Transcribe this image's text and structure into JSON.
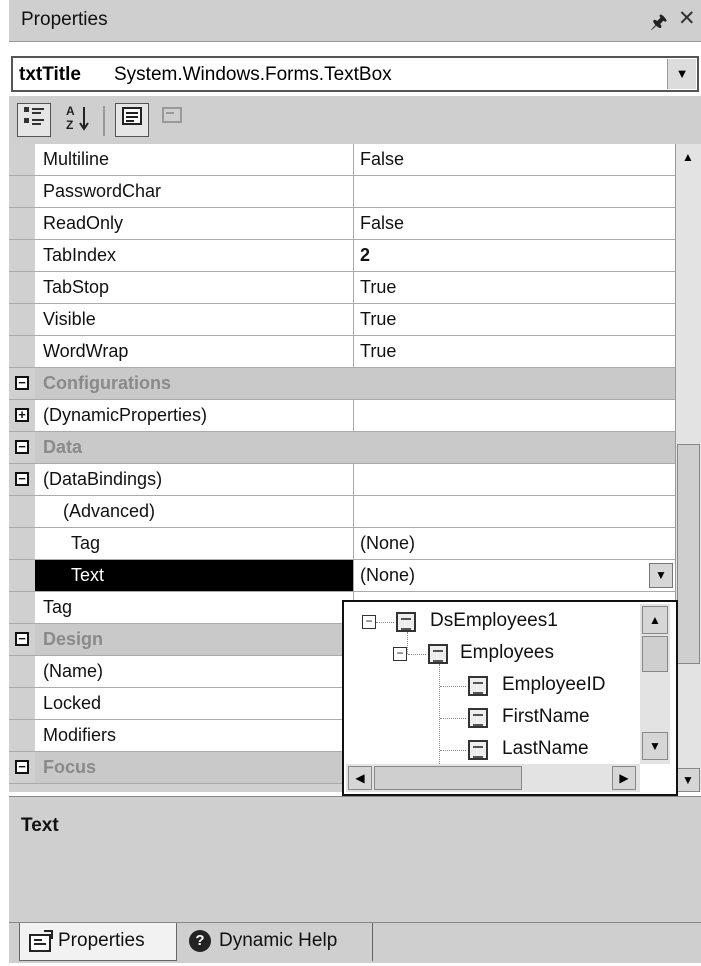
{
  "panel": {
    "title": "Properties",
    "pin_icon": "pin-icon",
    "close_icon": "close-icon"
  },
  "object_selector": {
    "name": "txtTitle",
    "type": "System.Windows.Forms.TextBox"
  },
  "toolbar": {
    "buttons": [
      "categorized-icon",
      "alphabetical-icon",
      "properties-icon",
      "events-icon"
    ]
  },
  "grid": {
    "rows": [
      {
        "label": "Multiline",
        "value": "False"
      },
      {
        "label": "PasswordChar",
        "value": ""
      },
      {
        "label": "ReadOnly",
        "value": "False"
      },
      {
        "label": "TabIndex",
        "value": "2"
      },
      {
        "label": "TabStop",
        "value": "True"
      },
      {
        "label": "Visible",
        "value": "True"
      },
      {
        "label": "WordWrap",
        "value": "True"
      },
      {
        "label": "Configurations",
        "expander": "−"
      },
      {
        "label": "(DynamicProperties)",
        "expander": "+",
        "value": ""
      },
      {
        "label": "Data",
        "expander": "−"
      },
      {
        "label": "(DataBindings)",
        "expander": "−",
        "value": ""
      },
      {
        "label": "(Advanced)",
        "value": ""
      },
      {
        "label": "Tag",
        "value": "(None)"
      },
      {
        "label": "Text",
        "value": "(None)"
      },
      {
        "label": "Tag",
        "value": ""
      },
      {
        "label": "Design",
        "expander": "−"
      },
      {
        "label": "(Name)",
        "value": ""
      },
      {
        "label": "Locked",
        "value": ""
      },
      {
        "label": "Modifiers",
        "value": ""
      },
      {
        "label": "Focus",
        "expander": "−"
      }
    ]
  },
  "dropdown_tree": {
    "items": [
      {
        "label": "DsEmployees1",
        "expander": "−"
      },
      {
        "label": "Employees",
        "expander": "−"
      },
      {
        "label": "EmployeeID"
      },
      {
        "label": "FirstName"
      },
      {
        "label": "LastName"
      }
    ]
  },
  "description": {
    "title": "Text"
  },
  "tabs": [
    {
      "label": "Properties",
      "icon": "properties-tab-icon"
    },
    {
      "label": "Dynamic Help",
      "icon": "help-icon"
    }
  ]
}
